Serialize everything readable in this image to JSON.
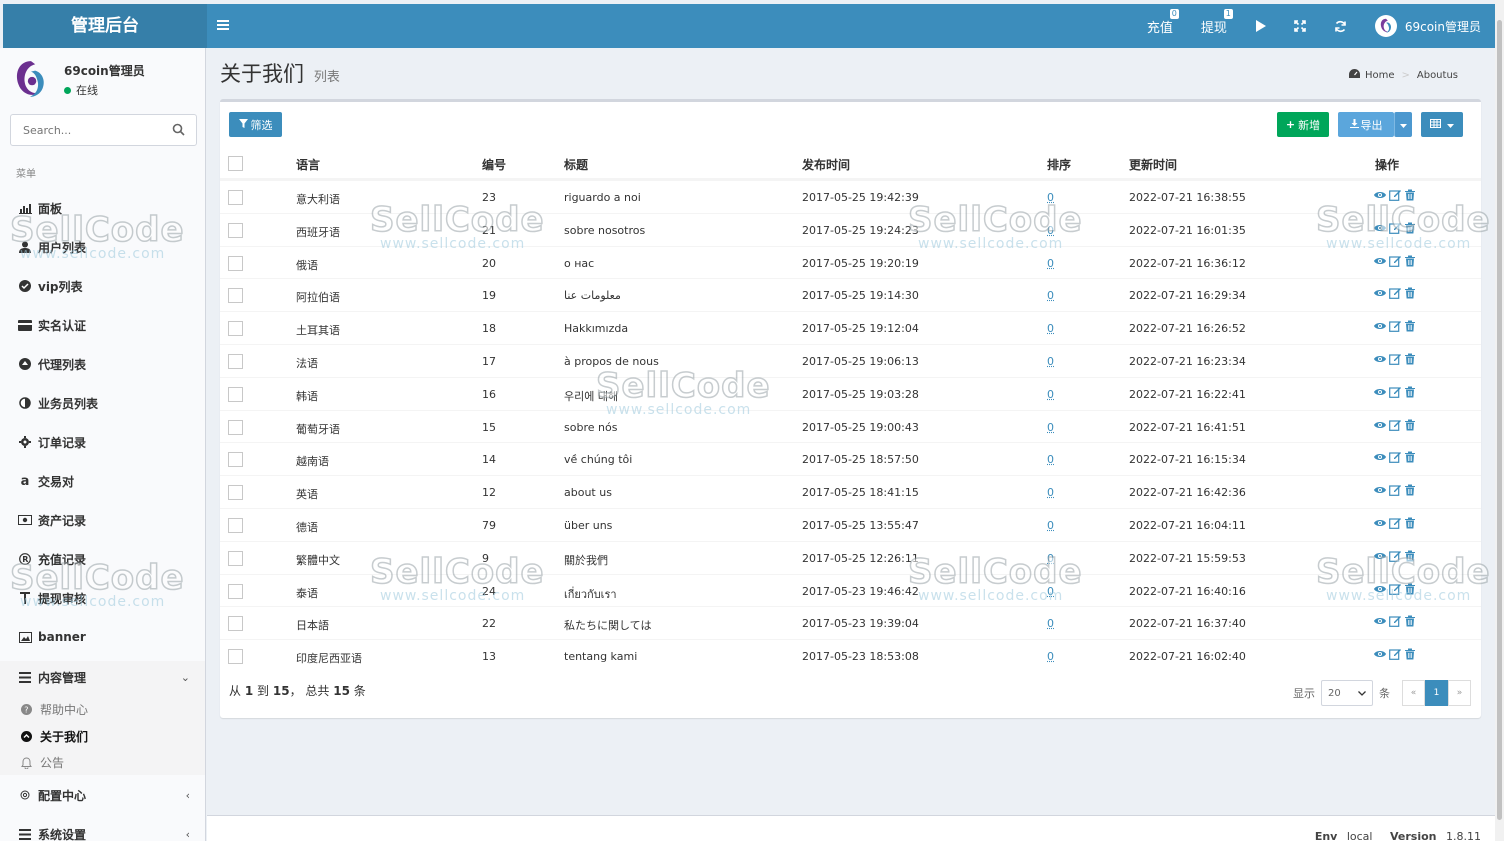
{
  "header": {
    "logo_text": "管理后台",
    "recharge_label": "充值",
    "recharge_badge": "0",
    "withdraw_label": "提现",
    "withdraw_badge": "1",
    "user_name": "69coin管理员"
  },
  "sidebar": {
    "user_name": "69coin管理员",
    "user_status": "在线",
    "search_placeholder": "Search...",
    "menu_header": "菜单",
    "items": [
      {
        "label": "面板",
        "icon": "chart-icon"
      },
      {
        "label": "用户列表",
        "icon": "user-icon"
      },
      {
        "label": "vip列表",
        "icon": "check-circle-icon"
      },
      {
        "label": "实名认证",
        "icon": "card-icon"
      },
      {
        "label": "代理列表",
        "icon": "arrow-circle-icon"
      },
      {
        "label": "业务员列表",
        "icon": "half-circle-icon"
      },
      {
        "label": "订单记录",
        "icon": "cog-icon"
      },
      {
        "label": "交易对",
        "icon": "amazon-icon"
      },
      {
        "label": "资产记录",
        "icon": "money-icon"
      },
      {
        "label": "充值记录",
        "icon": "registered-icon"
      },
      {
        "label": "提现审核",
        "icon": "text-cursor-icon"
      },
      {
        "label": "banner",
        "icon": "image-icon"
      },
      {
        "label": "内容管理",
        "icon": "list-icon"
      }
    ],
    "sub_items": [
      {
        "label": "帮助中心",
        "icon": "question-icon"
      },
      {
        "label": "关于我们",
        "icon": "chevron-circle-icon"
      },
      {
        "label": "公告",
        "icon": "bell-icon"
      }
    ],
    "bottom_items": [
      {
        "label": "配置中心",
        "icon": "cog-outline-icon"
      },
      {
        "label": "系统设置",
        "icon": "list-icon"
      }
    ]
  },
  "page": {
    "title": "关于我们",
    "subtitle": "列表",
    "breadcrumb_home": "Home",
    "breadcrumb_current": "Aboutus"
  },
  "toolbar": {
    "filter_label": "筛选",
    "add_label": "新增",
    "export_label": "导出"
  },
  "table": {
    "columns": [
      "语言",
      "编号",
      "标题",
      "发布时间",
      "排序",
      "更新时间",
      "操作"
    ],
    "rows": [
      {
        "lang": "意大利语",
        "id": "23",
        "title": "riguardo a noi",
        "published": "2017-05-25 19:42:39",
        "sort": "0",
        "updated": "2022-07-21 16:38:55"
      },
      {
        "lang": "西班牙语",
        "id": "21",
        "title": "sobre nosotros",
        "published": "2017-05-25 19:24:23",
        "sort": "0",
        "updated": "2022-07-21 16:01:35"
      },
      {
        "lang": "俄语",
        "id": "20",
        "title": "о нас",
        "published": "2017-05-25 19:20:19",
        "sort": "0",
        "updated": "2022-07-21 16:36:12"
      },
      {
        "lang": "阿拉伯语",
        "id": "19",
        "title": "معلومات عنا",
        "published": "2017-05-25 19:14:30",
        "sort": "0",
        "updated": "2022-07-21 16:29:34"
      },
      {
        "lang": "土耳其语",
        "id": "18",
        "title": "Hakkımızda",
        "published": "2017-05-25 19:12:04",
        "sort": "0",
        "updated": "2022-07-21 16:26:52"
      },
      {
        "lang": "法语",
        "id": "17",
        "title": "à propos de nous",
        "published": "2017-05-25 19:06:13",
        "sort": "0",
        "updated": "2022-07-21 16:23:34"
      },
      {
        "lang": "韩语",
        "id": "16",
        "title": "우리에 대해",
        "published": "2017-05-25 19:03:28",
        "sort": "0",
        "updated": "2022-07-21 16:22:41"
      },
      {
        "lang": "葡萄牙语",
        "id": "15",
        "title": "sobre nós",
        "published": "2017-05-25 19:00:43",
        "sort": "0",
        "updated": "2022-07-21 16:41:51"
      },
      {
        "lang": "越南语",
        "id": "14",
        "title": "về chúng tôi",
        "published": "2017-05-25 18:57:50",
        "sort": "0",
        "updated": "2022-07-21 16:15:34"
      },
      {
        "lang": "英语",
        "id": "12",
        "title": "about us",
        "published": "2017-05-25 18:41:15",
        "sort": "0",
        "updated": "2022-07-21 16:42:36"
      },
      {
        "lang": "德语",
        "id": "79",
        "title": "über uns",
        "published": "2017-05-25 13:55:47",
        "sort": "0",
        "updated": "2022-07-21 16:04:11"
      },
      {
        "lang": "繁體中文",
        "id": "9",
        "title": "關於我們",
        "published": "2017-05-25 12:26:11",
        "sort": "0",
        "updated": "2022-07-21 15:59:53"
      },
      {
        "lang": "泰语",
        "id": "24",
        "title": "เกี่ยวกับเรา",
        "published": "2017-05-23 19:46:42",
        "sort": "0",
        "updated": "2022-07-21 16:40:16"
      },
      {
        "lang": "日本語",
        "id": "22",
        "title": "私たちに関しては",
        "published": "2017-05-23 19:39:04",
        "sort": "0",
        "updated": "2022-07-21 16:37:40"
      },
      {
        "lang": "印度尼西亚语",
        "id": "13",
        "title": "tentang kami",
        "published": "2017-05-23 18:53:08",
        "sort": "0",
        "updated": "2022-07-21 16:02:40"
      }
    ]
  },
  "summary": {
    "prefix": "从",
    "from": "1",
    "to_word": "到",
    "to": "15",
    "total_word": "，  总共",
    "total": "15",
    "suffix": "条"
  },
  "pagination": {
    "show_label": "显示",
    "page_size": "20",
    "unit_label": "条",
    "prev": "«",
    "current": "1",
    "next": "»"
  },
  "footer": {
    "env_label": "Env",
    "env_value": "local",
    "version_label": "Version",
    "version_value": "1.8.11"
  },
  "watermark": {
    "brand": "SellCode",
    "url": "www.sellcode.com"
  },
  "colors": {
    "header": "#3c8dbc",
    "logo_bg": "#367fa9",
    "success": "#00a65a",
    "link": "#3c8dbc"
  }
}
